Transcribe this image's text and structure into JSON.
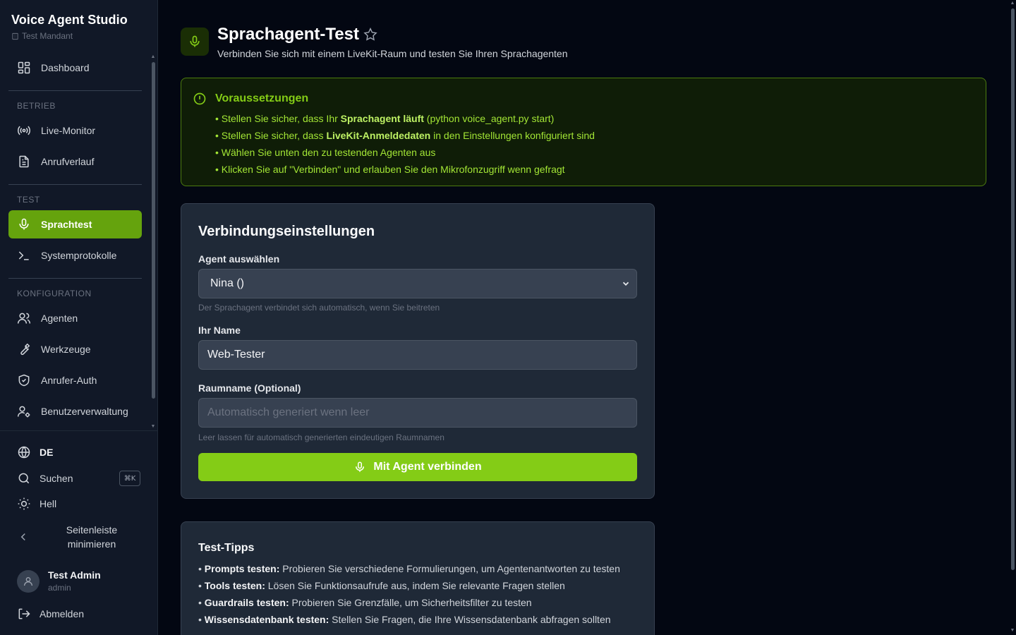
{
  "brand": {
    "title": "Voice Agent Studio",
    "tenant": "Test Mandant"
  },
  "nav": {
    "dashboard": "Dashboard",
    "section_betrieb": "BETRIEB",
    "live_monitor": "Live-Monitor",
    "anrufverlauf": "Anrufverlauf",
    "section_test": "TEST",
    "sprachtest": "Sprachtest",
    "systemprotokolle": "Systemprotokolle",
    "section_konfiguration": "KONFIGURATION",
    "agenten": "Agenten",
    "werkzeuge": "Werkzeuge",
    "anrufer_auth": "Anrufer-Auth",
    "benutzerverwaltung": "Benutzerverwaltung"
  },
  "bottom": {
    "language": "DE",
    "search": "Suchen",
    "search_shortcut": "⌘K",
    "theme": "Hell",
    "collapse": "Seitenleiste minimieren",
    "user_name": "Test Admin",
    "user_role": "admin",
    "logout": "Abmelden"
  },
  "header": {
    "title": "Sprachagent-Test",
    "subtitle": "Verbinden Sie sich mit einem LiveKit-Raum und testen Sie Ihren Sprachagenten"
  },
  "prereq": {
    "title": "Voraussetzungen",
    "items": [
      {
        "pre": "• Stellen Sie sicher, dass Ihr ",
        "bold": "Sprachagent läuft",
        "post": " (python voice_agent.py start)"
      },
      {
        "pre": "• Stellen Sie sicher, dass ",
        "bold": "LiveKit-Anmeldedaten",
        "post": " in den Einstellungen konfiguriert sind"
      },
      {
        "pre": "• Wählen Sie unten den zu testenden Agenten aus",
        "bold": "",
        "post": ""
      },
      {
        "pre": "• Klicken Sie auf \"Verbinden\" und erlauben Sie den Mikrofonzugriff wenn gefragt",
        "bold": "",
        "post": ""
      }
    ]
  },
  "settings": {
    "title": "Verbindungseinstellungen",
    "agent_label": "Agent auswählen",
    "agent_value": "Nina ()",
    "agent_hint": "Der Sprachagent verbindet sich automatisch, wenn Sie beitreten",
    "name_label": "Ihr Name",
    "name_value": "Web-Tester",
    "room_label": "Raumname (Optional)",
    "room_placeholder": "Automatisch generiert wenn leer",
    "room_hint": "Leer lassen für automatisch generierten eindeutigen Raumnamen",
    "connect_button": "Mit Agent verbinden"
  },
  "tips": {
    "title": "Test-Tipps",
    "items": [
      {
        "bold": "Prompts testen:",
        "text": " Probieren Sie verschiedene Formulierungen, um Agentenantworten zu testen"
      },
      {
        "bold": "Tools testen:",
        "text": " Lösen Sie Funktionsaufrufe aus, indem Sie relevante Fragen stellen"
      },
      {
        "bold": "Guardrails testen:",
        "text": " Probieren Sie Grenzfälle, um Sicherheitsfilter zu testen"
      },
      {
        "bold": "Wissensdatenbank testen:",
        "text": " Stellen Sie Fragen, die Ihre Wissensdatenbank abfragen sollten"
      }
    ]
  },
  "colors": {
    "accent": "#84cc16",
    "active_nav": "#65a30d",
    "background": "#030712",
    "sidebar": "#111827",
    "card": "#1f2937"
  }
}
